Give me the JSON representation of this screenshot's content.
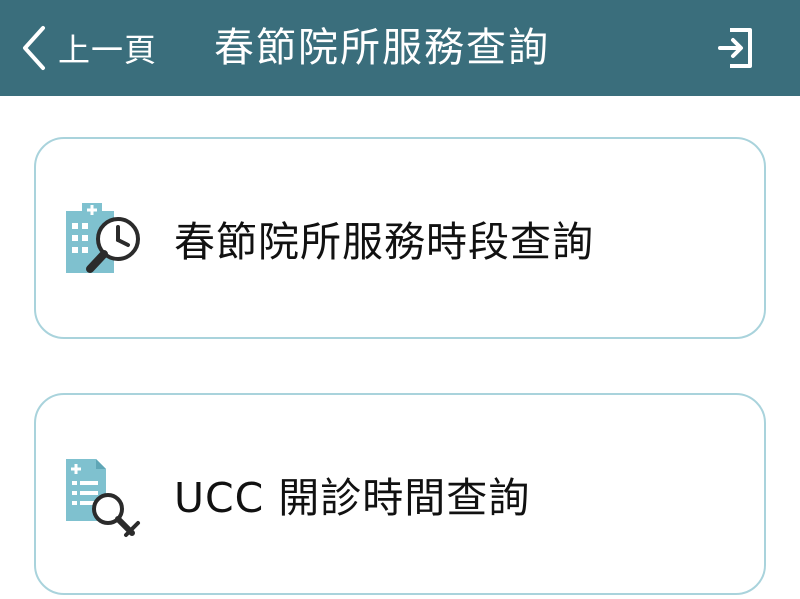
{
  "header": {
    "back_label": "上一頁",
    "title": "春節院所服務查詢",
    "background_color": "#3a6e7c"
  },
  "icons": {
    "back": "chevron-left-icon",
    "logout": "logout-icon",
    "card_1": "clinic-clock-search-icon",
    "card_2": "document-search-icon"
  },
  "cards": [
    {
      "label": "春節院所服務時段查詢"
    },
    {
      "label": "UCC 開診時間查詢"
    }
  ],
  "colors": {
    "accent": "#7fc1cf",
    "card_border": "#a9d3dc",
    "icon_dark": "#2b2b2b"
  }
}
